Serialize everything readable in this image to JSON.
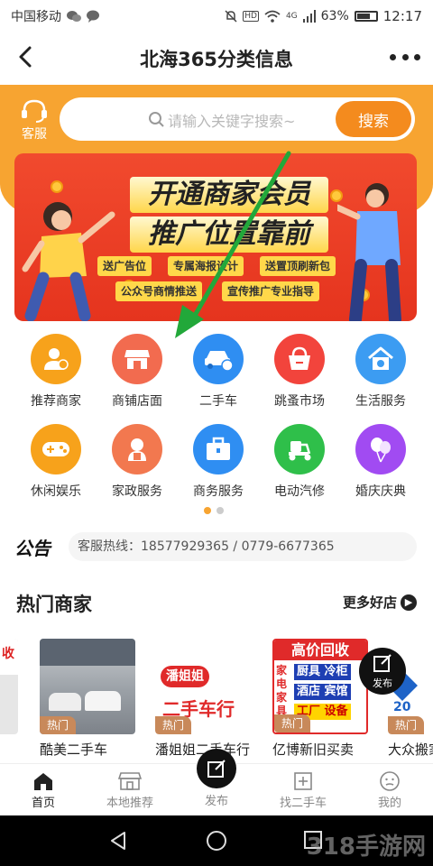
{
  "status_bar": {
    "carrier": "中国移动",
    "network": "4G",
    "battery": "63%",
    "time": "12:17"
  },
  "header": {
    "title": "北海365分类信息"
  },
  "service": {
    "label": "客服"
  },
  "search": {
    "placeholder": "请输入关键字搜索~",
    "button": "搜索"
  },
  "banner": {
    "line1": "开通商家会员",
    "line2": "推广位置靠前",
    "tags": [
      "送广告位",
      "专属海报设计",
      "送置顶刷新包",
      "公众号商情推送",
      "宣传推广专业指导"
    ]
  },
  "categories": [
    {
      "label": "推荐商家",
      "color": "#f7a21b",
      "icon": "recommend-icon"
    },
    {
      "label": "商铺店面",
      "color": "#f26b4f",
      "icon": "shop-icon"
    },
    {
      "label": "二手车",
      "color": "#2f8ef2",
      "icon": "car-icon"
    },
    {
      "label": "跳蚤市场",
      "color": "#f2443c",
      "icon": "basket-icon"
    },
    {
      "label": "生活服务",
      "color": "#3c9cf2",
      "icon": "house-icon"
    },
    {
      "label": "休闲娱乐",
      "color": "#f7a21b",
      "icon": "gamepad-icon"
    },
    {
      "label": "家政服务",
      "color": "#f2784f",
      "icon": "maid-icon"
    },
    {
      "label": "商务服务",
      "color": "#2f8ef2",
      "icon": "briefcase-icon"
    },
    {
      "label": "电动汽修",
      "color": "#2fbf4a",
      "icon": "scooter-icon"
    },
    {
      "label": "婚庆庆典",
      "color": "#a14bf2",
      "icon": "balloon-icon"
    }
  ],
  "notice": {
    "logo": "公告",
    "text": "客服热线：18577929365 / 0779-6677365"
  },
  "hot": {
    "title": "热门商家",
    "more": "更多好店",
    "badge": "热门",
    "shops": [
      {
        "name": "酷美二手车"
      },
      {
        "name": "潘姐姐二手车行"
      },
      {
        "name": "亿博新旧买卖"
      },
      {
        "name": "大众搬家"
      }
    ],
    "shop2_sign": "潘姐姐",
    "shop2_sub": "二手车行",
    "shop3_lines": [
      "高价回收",
      "厨具 冷柜",
      "酒店 宾馆",
      "工厂 设备"
    ],
    "shop3_side": "家电家具"
  },
  "fab": {
    "label": "发布"
  },
  "tabs": [
    {
      "label": "首页",
      "icon": "home-icon"
    },
    {
      "label": "本地推荐",
      "icon": "store-icon"
    },
    {
      "label": "发布",
      "icon": "edit-icon"
    },
    {
      "label": "找二手车",
      "icon": "plus-square-icon"
    },
    {
      "label": "我的",
      "icon": "face-icon"
    }
  ],
  "watermark": "318手游网"
}
